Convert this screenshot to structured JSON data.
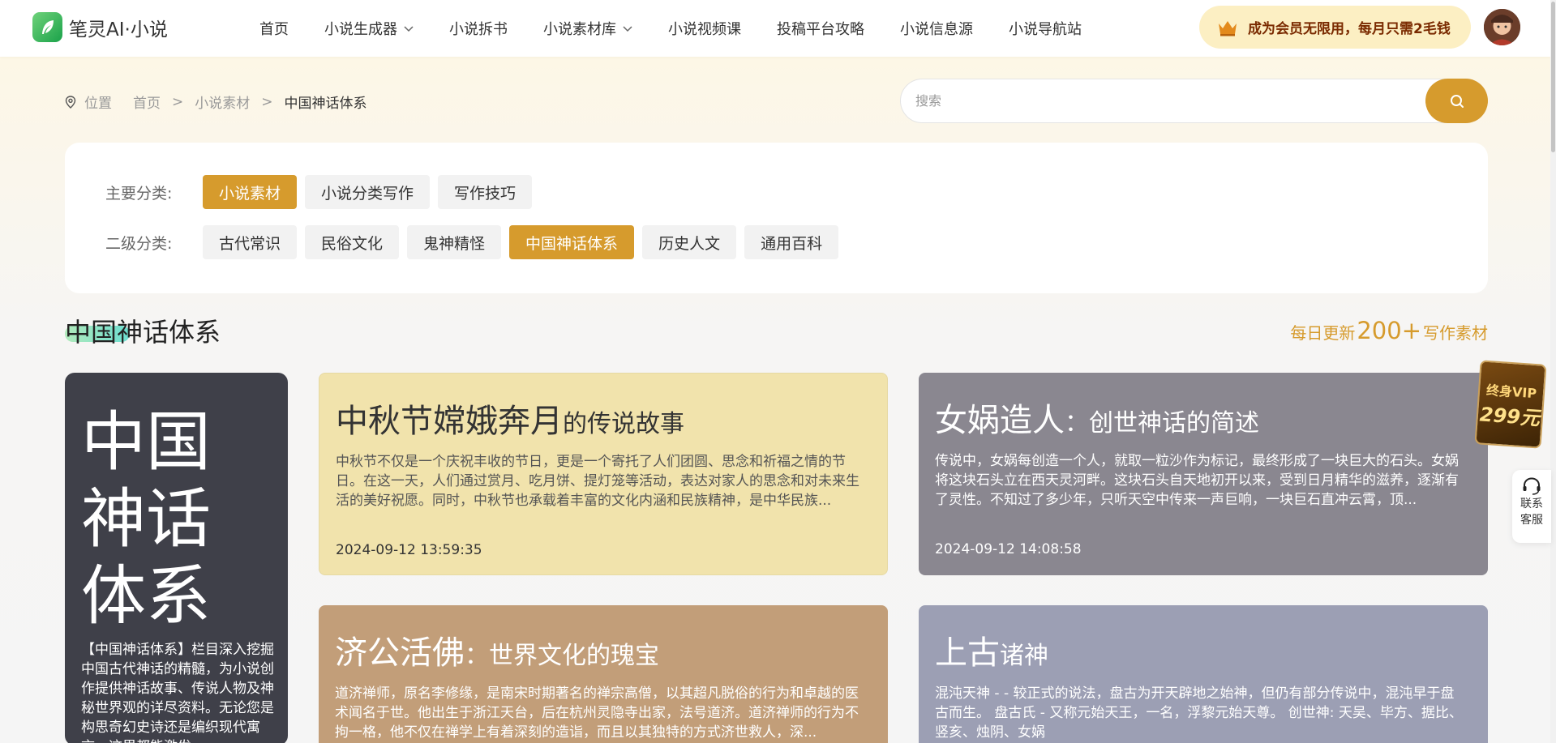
{
  "header": {
    "logo_text": "笔灵AI·小说",
    "nav": [
      {
        "label": "首页",
        "has_dropdown": false
      },
      {
        "label": "小说生成器",
        "has_dropdown": true
      },
      {
        "label": "小说拆书",
        "has_dropdown": false
      },
      {
        "label": "小说素材库",
        "has_dropdown": true
      },
      {
        "label": "小说视频课",
        "has_dropdown": false
      },
      {
        "label": "投稿平台攻略",
        "has_dropdown": false
      },
      {
        "label": "小说信息源",
        "has_dropdown": false
      },
      {
        "label": "小说导航站",
        "has_dropdown": false
      }
    ],
    "vip_text": "成为会员无限用，每月只需2毛钱"
  },
  "breadcrumb": {
    "location_label": "位置",
    "items": [
      "首页",
      "小说素材",
      "中国神话体系"
    ],
    "separator": ">"
  },
  "search": {
    "placeholder": "搜索",
    "value": ""
  },
  "filters": {
    "primary_label": "主要分类:",
    "primary": [
      {
        "label": "小说素材",
        "active": true
      },
      {
        "label": "小说分类写作",
        "active": false
      },
      {
        "label": "写作技巧",
        "active": false
      }
    ],
    "secondary_label": "二级分类:",
    "secondary": [
      {
        "label": "古代常识",
        "active": false
      },
      {
        "label": "民俗文化",
        "active": false
      },
      {
        "label": "鬼神精怪",
        "active": false
      },
      {
        "label": "中国神话体系",
        "active": true
      },
      {
        "label": "历史人文",
        "active": false
      },
      {
        "label": "通用百科",
        "active": false
      }
    ]
  },
  "section": {
    "title": "中国神话体系",
    "daily_prefix": "每日更新",
    "daily_count": "200+",
    "daily_suffix": "写作素材"
  },
  "intro": {
    "title": "中国神话体系",
    "description": "【中国神话体系】栏目深入挖掘中国古代神话的精髓，为小说创作提供神话故事、传说人物及神秘世界观的详尽资料。无论您是构思奇幻史诗还是编织现代寓言，这里都能激发"
  },
  "articles": [
    {
      "title_main": "中秋节嫦娥奔月",
      "title_sub": "的传说故事",
      "desc": "中秋节不仅是一个庆祝丰收的节日，更是一个寄托了人们团圆、思念和祈福之情的节日。在这一天，人们通过赏月、吃月饼、提灯笼等活动，表达对家人的思念和对未来生活的美好祝愿。同时，中秋节也承载着丰富的文化内涵和民族精神，是中华民族...",
      "date": "2024-09-12 13:59:35"
    },
    {
      "title_main": "女娲造人",
      "title_sub": "：创世神话的简述",
      "desc": "传说中，女娲每创造一个人，就取一粒沙作为标记，最终形成了一块巨大的石头。女娲将这块石头立在西天灵河畔。这块石头自天地初开以来，受到日月精华的滋养，逐渐有了灵性。不知过了多少年，只听天空中传来一声巨响，一块巨石直冲云霄，顶...",
      "date": "2024-09-12 14:08:58"
    },
    {
      "title_main": "济公活佛",
      "title_sub": "：世界文化的瑰宝",
      "desc": "道济禅师，原名李修缘，是南宋时期著名的禅宗高僧，以其超凡脱俗的行为和卓越的医术闻名于世。他出生于浙江天台，后在杭州灵隐寺出家，法号道济。道济禅师的行为不拘一格，他不仅在禅学上有着深刻的造诣，而且以其独特的方式济世救人，深...",
      "date": ""
    },
    {
      "title_main": "上古",
      "title_sub": "诸神",
      "desc": "混沌天神 - - 较正式的说法，盘古为开天辟地之始神，但仍有部分传说中，混沌早于盘古而生。 盘古氏 - 又称元始天王，一名，浮黎元始天尊。 创世神: 天吴、毕方、据比、竖亥、烛阴、女娲",
      "date": ""
    }
  ],
  "floating": {
    "vip_line1": "终身VIP",
    "vip_line2": "299元",
    "service_label": "联系客服"
  },
  "colors": {
    "accent": "#d69b2d",
    "vip_text": "#7a2a00",
    "intro_bg": "#3f4049"
  }
}
